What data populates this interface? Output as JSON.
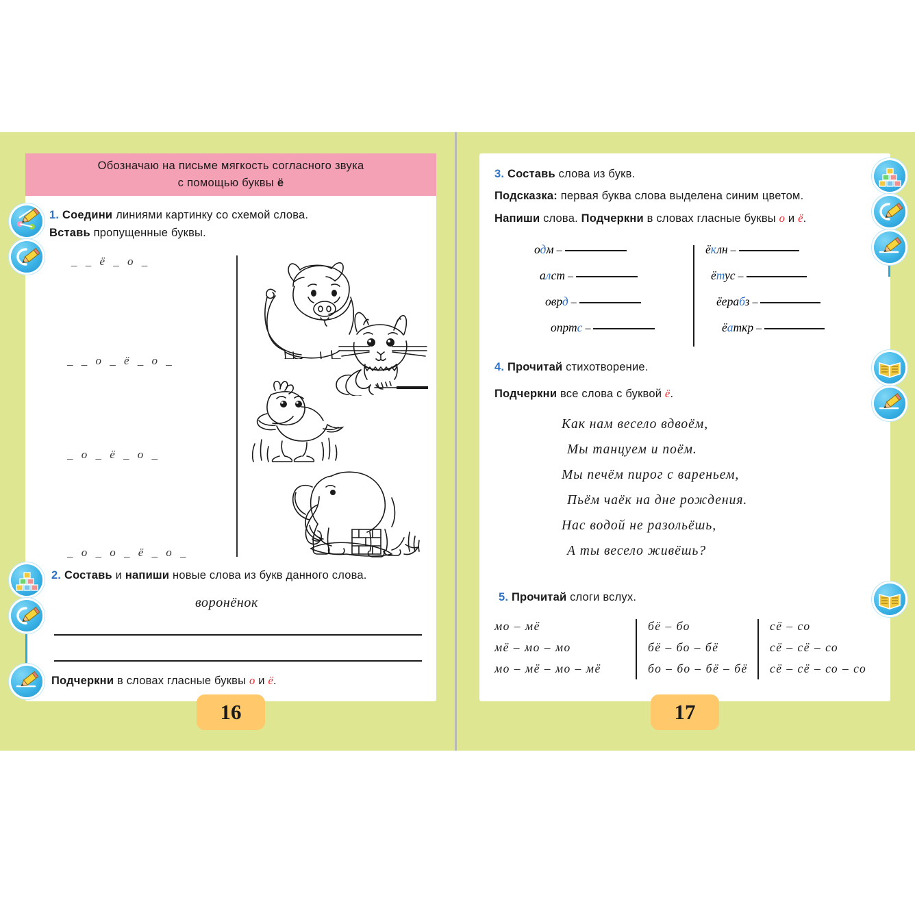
{
  "spread": {
    "left_page_number": "16",
    "right_page_number": "17",
    "bg_color": "#dfe692",
    "banner_color": "#f4a0b5",
    "accent_blue": "#2f72c4",
    "accent_red": "#e8262b",
    "page_tab_color": "#ffc96b"
  },
  "banner": {
    "line1": "Обозначаю  на  письме  мягкость  согласного  звука",
    "line2_prefix": "с  помощью  буквы  ",
    "line2_letter": "ё"
  },
  "task1": {
    "number": "1.",
    "bold1": "Соедини",
    "rest1": " линиями  картинку  со  схемой  слова.",
    "bold2": "Вставь",
    "rest2": " пропущенные  буквы.",
    "schemes": [
      "_  _  ё  _  о  _",
      "_  _  о  _  ё  _  о  _",
      "_  о  _  ё  _  о  _",
      "_  о  _  о  _  ё  _  о  _"
    ],
    "pictures": [
      "piglet",
      "kitten",
      "duckling",
      "elephant"
    ],
    "icons": [
      "connect-lines-pencil-icon",
      "write-pencil-icon"
    ]
  },
  "task2": {
    "number": "2.",
    "bold1": "Составь",
    "mid1": " и ",
    "bold2": "напиши",
    "rest": " новые  слова  из  букв  данного  слова.",
    "word": "воронёнок",
    "blank_lines": 2,
    "footer_bold": "Подчеркни",
    "footer_mid": " в  словах  гласные  буквы  ",
    "footer_letter1": "о",
    "footer_and": " и ",
    "footer_letter2": "ё",
    "footer_end": ".",
    "icons": [
      "blocks-icon",
      "write-pencil-icon",
      "underline-pencil-icon"
    ]
  },
  "task3": {
    "number": "3.",
    "bold1": "Составь",
    "rest1": " слова  из  букв.",
    "hint_bold": "Подсказка:",
    "hint_rest": " первая  буква  слова  выделена  синим  цветом.",
    "line3_bold1": "Напиши",
    "line3_mid1": " слова. ",
    "line3_bold2": "Подчеркни",
    "line3_mid2": " в  словах  гласные  буквы  ",
    "line3_letter1": "о",
    "line3_and": " и ",
    "line3_letter2": "ё",
    "line3_end": ".",
    "left_column": [
      {
        "letters": "одм",
        "blue_index": 1
      },
      {
        "letters": "алст",
        "blue_index": 1
      },
      {
        "letters": "оврд",
        "blue_index": 3
      },
      {
        "letters": "опртс",
        "blue_index": 4
      }
    ],
    "right_column": [
      {
        "letters": "ёклн",
        "blue_index": 1
      },
      {
        "letters": "ётус",
        "blue_index": 1
      },
      {
        "letters": "ёерабз",
        "blue_index": 4
      },
      {
        "letters": "ёаткр",
        "blue_index": 1
      }
    ],
    "icons": [
      "blocks-icon",
      "write-pencil-icon",
      "underline-pencil-icon"
    ]
  },
  "task4": {
    "number": "4.",
    "bold1": "Прочитай",
    "rest1": " стихотворение.",
    "bold2": "Подчеркни",
    "mid2": " все  слова  с  буквой  ",
    "letter": "ё",
    "end2": ".",
    "poem": [
      "Как нам весело вдвоём,",
      "Мы танцуем  и  поём.",
      "Мы печём пирог с вареньем,",
      "Пьём чаёк  на  дне рождения.",
      "Нас водой  не  разольёшь,",
      "А ты весело живёшь?"
    ],
    "icons": [
      "open-book-icon",
      "underline-pencil-icon"
    ]
  },
  "task5": {
    "number": "5.",
    "bold1": "Прочитай",
    "rest1": " слоги  вслух.",
    "columns": [
      [
        "мо – мё",
        "мё – мо – мо",
        "мо – мё – мо – мё"
      ],
      [
        "бё – бо",
        "бё – бо – бё",
        "бо – бо – бё – бё"
      ],
      [
        "сё – со",
        "сё – сё – со",
        "сё – сё – со – со"
      ]
    ],
    "icons": [
      "open-book-icon"
    ]
  }
}
